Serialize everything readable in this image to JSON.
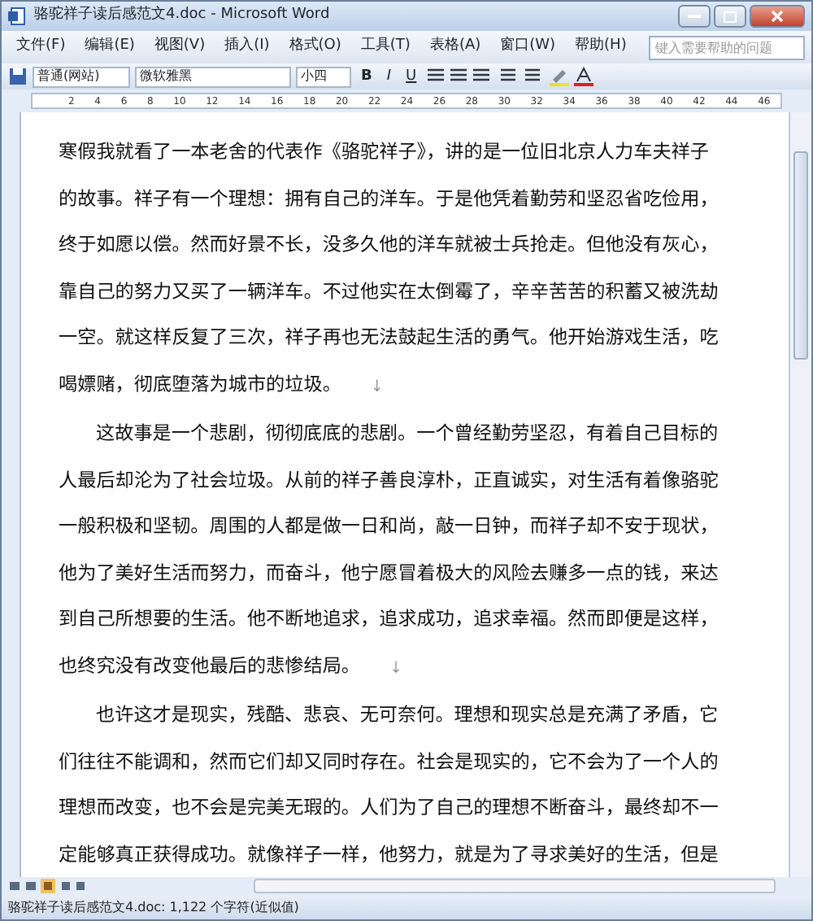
{
  "window": {
    "title": "骆驼祥子读后感范文4.doc - Microsoft Word"
  },
  "menu": [
    "文件(F)",
    "编辑(E)",
    "视图(V)",
    "插入(I)",
    "格式(O)",
    "工具(T)",
    "表格(A)",
    "窗口(W)",
    "帮助(H)"
  ],
  "help_search": {
    "placeholder": "键入需要帮助的问题"
  },
  "toolbar": {
    "style": "普通(网站)",
    "font": "微软雅黑",
    "size": "小四",
    "format_buttons": [
      "B",
      "I",
      "U"
    ]
  },
  "ruler": [
    "2",
    "4",
    "6",
    "8",
    "10",
    "12",
    "14",
    "16",
    "18",
    "20",
    "22",
    "24",
    "26",
    "28",
    "30",
    "32",
    "34",
    "36",
    "38",
    "40",
    "42",
    "44",
    "46"
  ],
  "paragraphs": [
    {
      "indent": false,
      "lines": [
        "寒假我就看了一本老舍的代表作《骆驼祥子》，讲的是一位旧北京人力车夫祥子",
        "的故事。祥子有一个理想：拥有自己的洋车。于是他凭着勤劳和坚忍省吃俭用，",
        "终于如愿以偿。然而好景不长，没多久他的洋车就被士兵抢走。但他没有灰心，",
        "靠自己的努力又买了一辆洋车。不过他实在太倒霉了，辛辛苦苦的积蓄又被洗劫",
        "一空。就这样反复了三次，祥子再也无法鼓起生活的勇气。他开始游戏生活，吃",
        "喝嫖赌，彻底堕落为城市的垃圾。"
      ],
      "mark": "↓"
    },
    {
      "indent": true,
      "lines": [
        "这故事是一个悲剧，彻彻底底的悲剧。一个曾经勤劳坚忍，有着自己目标的",
        "人最后却沦为了社会垃圾。从前的祥子善良淳朴，正直诚实，对生活有着像骆驼",
        "一般积极和坚韧。周围的人都是做一日和尚，敲一日钟，而祥子却不安于现状，",
        "他为了美好生活而努力，而奋斗，他宁愿冒着极大的风险去赚多一点的钱，来达",
        "到自己所想要的生活。他不断地追求，追求成功，追求幸福。然而即便是这样，",
        "也终究没有改变他最后的悲惨结局。"
      ],
      "mark": "↓"
    },
    {
      "indent": true,
      "lines": [
        "也许这才是现实，残酷、悲哀、无可奈何。理想和现实总是充满了矛盾，它",
        "们往往不能调和，然而它们却又同时存在。社会是现实的，它不会为了一个人的",
        "理想而改变，也不会是完美无瑕的。人们为了自己的理想不断奋斗，最终却不一",
        "定能够真正获得成功。就像祥子一样，他努力，就是为了寻求美好的生活，但是"
      ]
    }
  ],
  "status_bar": "骆驼祥子读后感范文4.doc: 1,122 个字符(近似值)"
}
